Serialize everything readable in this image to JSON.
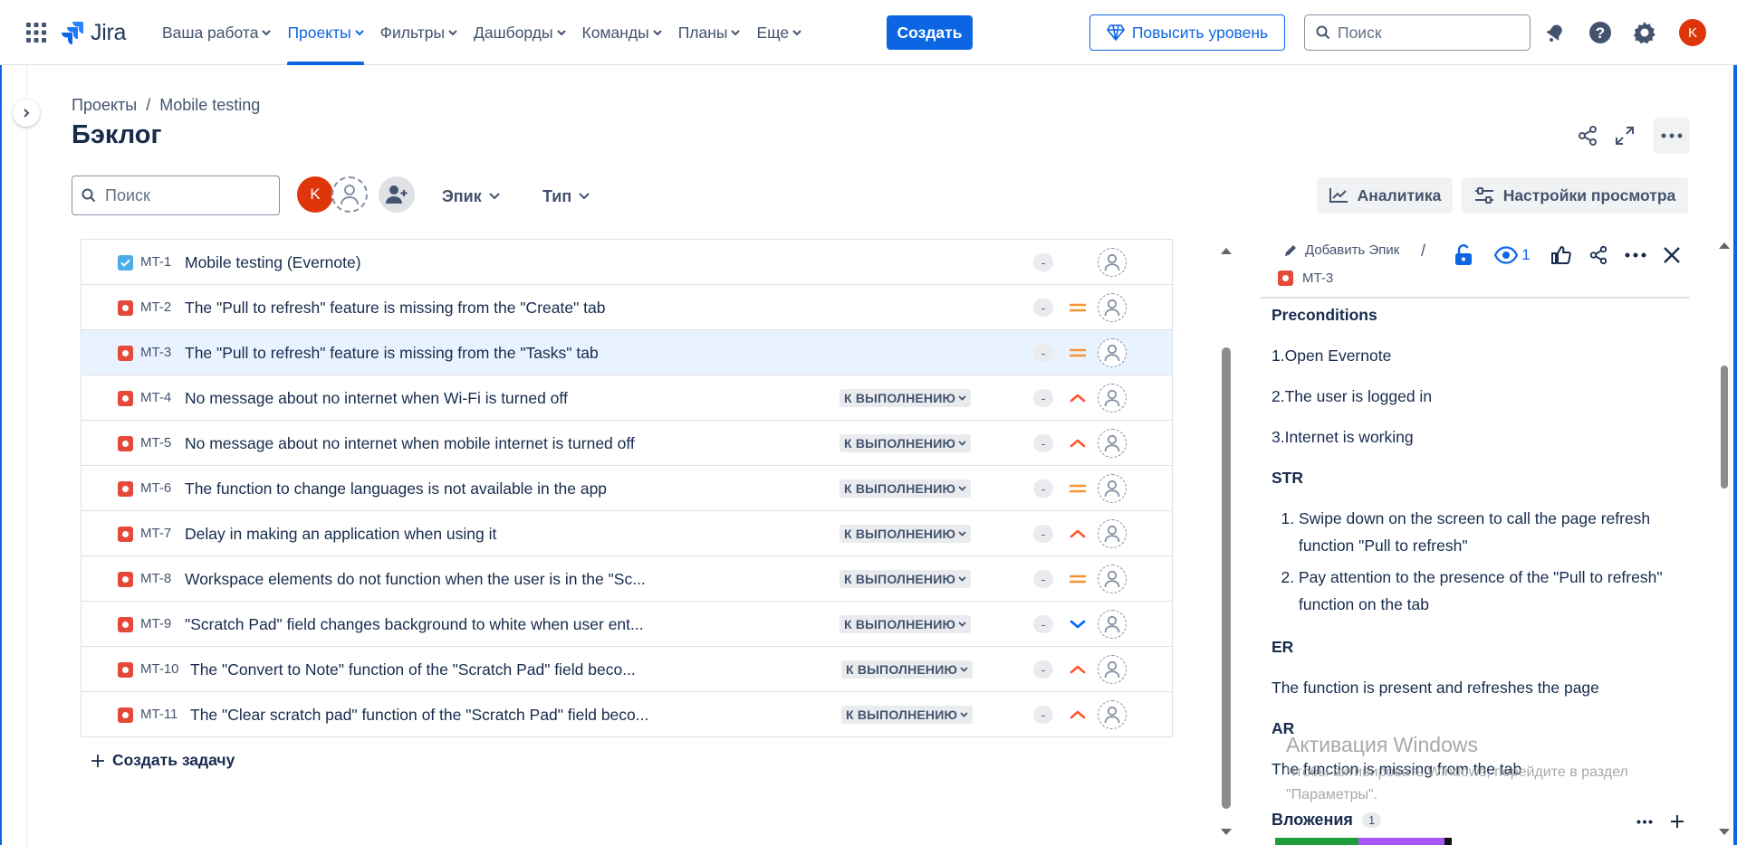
{
  "app": {
    "name": "Jira"
  },
  "nav": {
    "items": [
      {
        "label": "Ваша работа",
        "active": false
      },
      {
        "label": "Проекты",
        "active": true
      },
      {
        "label": "Фильтры",
        "active": false
      },
      {
        "label": "Дашборды",
        "active": false
      },
      {
        "label": "Команды",
        "active": false
      },
      {
        "label": "Планы",
        "active": false
      },
      {
        "label": "Еще",
        "active": false
      }
    ],
    "create_label": "Создать",
    "upgrade_label": "Повысить уровень",
    "search_placeholder": "Поиск",
    "user_initial": "K"
  },
  "header": {
    "breadcrumb": [
      "Проекты",
      "/",
      "Mobile testing"
    ],
    "title": "Бэклог"
  },
  "filters": {
    "search_placeholder": "Поиск",
    "user_initial": "K",
    "epic_label": "Эпик",
    "type_label": "Тип",
    "analytics_label": "Аналитика",
    "view_settings_label": "Настройки просмотра"
  },
  "backlog": {
    "rows": [
      {
        "key": "MT-1",
        "type": "task",
        "summary": "Mobile testing (Evernote)",
        "status": "",
        "estimate": "-",
        "priority": "none"
      },
      {
        "key": "MT-2",
        "type": "bug",
        "summary": "The \"Pull to refresh\" feature is missing from the \"Create\" tab",
        "status": "",
        "estimate": "-",
        "priority": "medium"
      },
      {
        "key": "MT-3",
        "type": "bug",
        "summary": "The \"Pull to refresh\" feature is missing from the \"Tasks\" tab",
        "status": "",
        "estimate": "-",
        "priority": "medium"
      },
      {
        "key": "MT-4",
        "type": "bug",
        "summary": "No message about no internet when Wi-Fi is turned off",
        "status": "К ВЫПОЛНЕНИЮ",
        "estimate": "-",
        "priority": "high"
      },
      {
        "key": "MT-5",
        "type": "bug",
        "summary": "No message about no internet when mobile internet is turned off",
        "status": "К ВЫПОЛНЕНИЮ",
        "estimate": "-",
        "priority": "high"
      },
      {
        "key": "MT-6",
        "type": "bug",
        "summary": "The function to change languages is not available in the app",
        "status": "К ВЫПОЛНЕНИЮ",
        "estimate": "-",
        "priority": "medium"
      },
      {
        "key": "MT-7",
        "type": "bug",
        "summary": "Delay in making an application when using it",
        "status": "К ВЫПОЛНЕНИЮ",
        "estimate": "-",
        "priority": "high"
      },
      {
        "key": "MT-8",
        "type": "bug",
        "summary": "Workspace elements do not function when the user is in the \"Sc...",
        "status": "К ВЫПОЛНЕНИЮ",
        "estimate": "-",
        "priority": "medium"
      },
      {
        "key": "MT-9",
        "type": "bug",
        "summary": "\"Scratch Pad\" field changes background to white when user ent...",
        "status": "К ВЫПОЛНЕНИЮ",
        "estimate": "-",
        "priority": "low"
      },
      {
        "key": "MT-10",
        "type": "bug",
        "summary": "The \"Convert to Note\" function of the \"Scratch Pad\" field beco...",
        "status": "К ВЫПОЛНЕНИЮ",
        "estimate": "-",
        "priority": "high"
      },
      {
        "key": "MT-11",
        "type": "bug",
        "summary": "The \"Clear scratch pad\" function of the \"Scratch Pad\" field beco...",
        "status": "К ВЫПОЛНЕНИЮ",
        "estimate": "-",
        "priority": "high"
      }
    ],
    "create_task_label": "Создать задачу"
  },
  "detail": {
    "add_epic_label": "Добавить Эпик",
    "separator": "/",
    "watch_count": "1",
    "issue_key": "MT-3",
    "preconditions_heading": "Preconditions",
    "preconditions": [
      "1.Open Evernote",
      "2.The user is logged in",
      "3.Internet is working"
    ],
    "str_heading": "STR",
    "steps": [
      "Swipe down on the screen to call the page refresh function \"Pull to refresh\"",
      "Pay attention to the presence of the \"Pull to refresh\" function on the tab"
    ],
    "er_heading": "ER",
    "er_text": "The function is present and refreshes the page",
    "ar_heading": "AR",
    "ar_text": "The function is missing from the tab",
    "attachments_label": "Вложения",
    "attachments_count": "1"
  },
  "watermark": {
    "title": "Активация Windows",
    "text": "Чтобы активировать Windows, перейдите в раздел \"Параметры\"."
  },
  "colors": {
    "brand": "#0c66e4",
    "bug": "#e5493a",
    "task": "#4bade8",
    "priority_medium": "#f79232",
    "priority_high": "#ff5630",
    "priority_low": "#0065ff"
  }
}
